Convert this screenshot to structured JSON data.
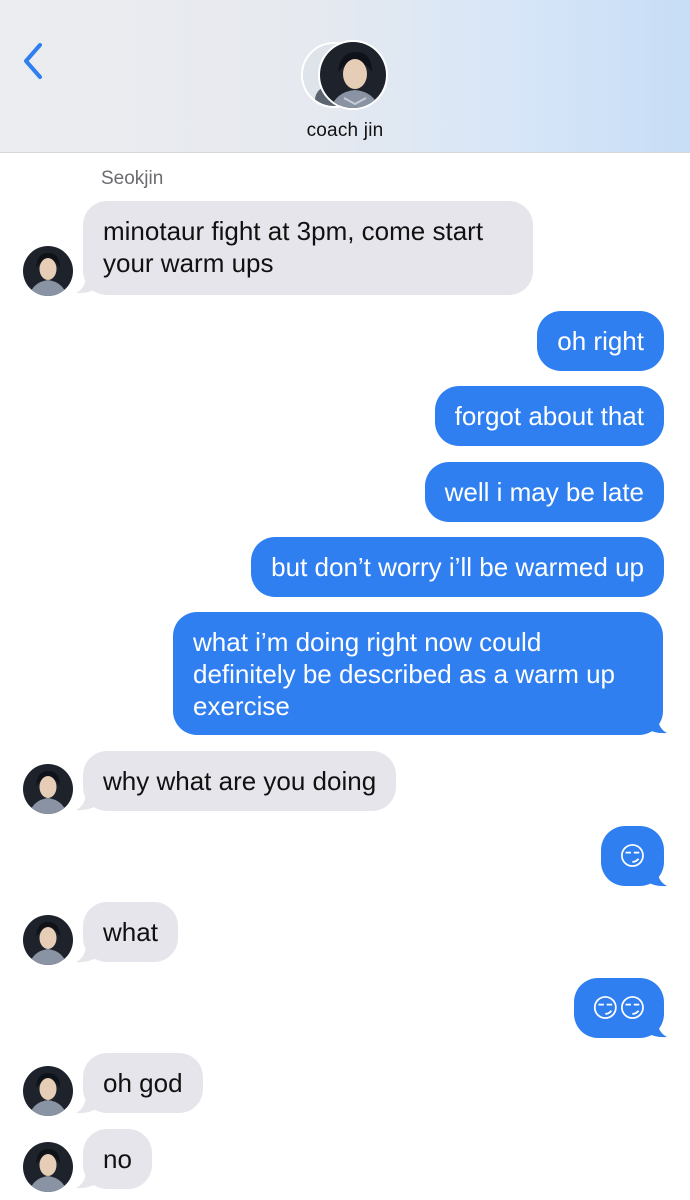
{
  "header": {
    "contact_name": "coach jin",
    "back_icon": "chevron-left-icon",
    "accent_color": "#2f7ff1"
  },
  "thread": {
    "sender_label": "Seokjin",
    "messages": [
      {
        "from": "them",
        "text": "minotaur fight at 3pm, come start your warm ups"
      },
      {
        "from": "me",
        "text": "oh right"
      },
      {
        "from": "me",
        "text": "forgot about that"
      },
      {
        "from": "me",
        "text": "well i may be late"
      },
      {
        "from": "me",
        "text": "but don’t worry i’ll be warmed up"
      },
      {
        "from": "me",
        "text": "what i’m doing right now could definitely be described as a warm up exercise"
      },
      {
        "from": "them",
        "text": "why what are you doing"
      },
      {
        "from": "me",
        "text": "😏"
      },
      {
        "from": "them",
        "text": "what"
      },
      {
        "from": "me",
        "text": "😏😏"
      },
      {
        "from": "them",
        "text": "oh god"
      },
      {
        "from": "them",
        "text": "no"
      }
    ]
  },
  "colors": {
    "incoming_bubble": "#e6e5eb",
    "outgoing_bubble": "#2f7ff1"
  }
}
